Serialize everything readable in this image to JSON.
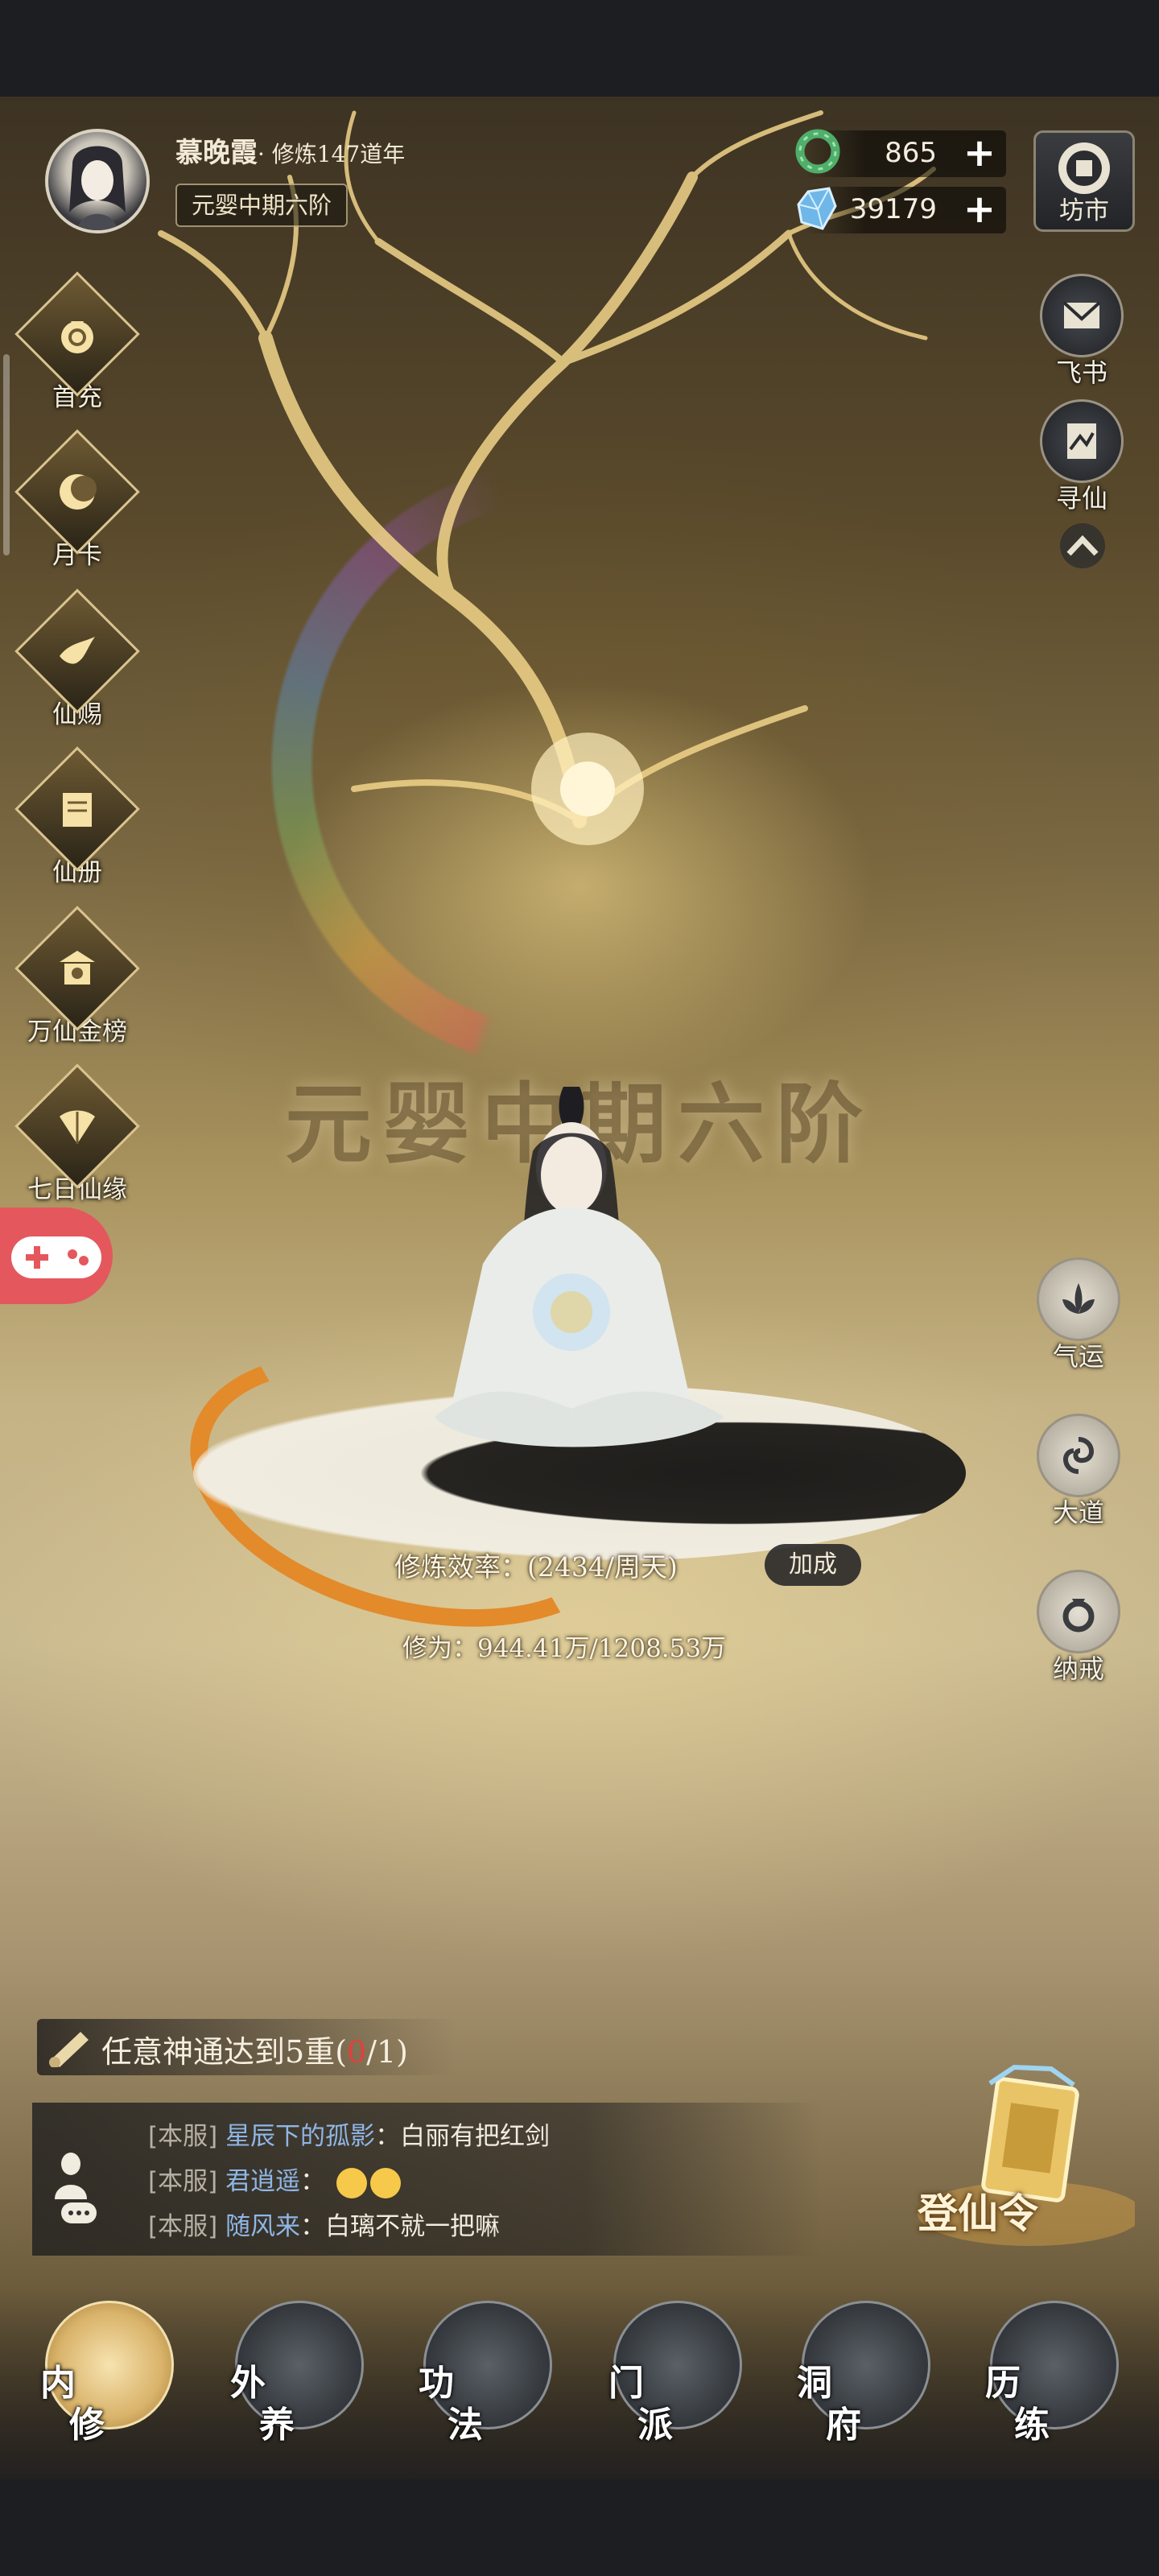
{
  "player": {
    "name": "慕晚霞",
    "cultivation_years": "· 修炼147道年",
    "realm_badge": "元婴中期六阶"
  },
  "currencies": [
    {
      "icon": "jade-ring-icon",
      "value": "865",
      "plus": "+"
    },
    {
      "icon": "spirit-crystal-icon",
      "value": "39179",
      "plus": "+"
    }
  ],
  "right_top": {
    "market": "坊市",
    "letters": "飞书",
    "seek": "寻仙",
    "collapse_icon": "chevron-up-icon"
  },
  "left_menu": [
    {
      "label": "首充",
      "icon": "money-bag-icon"
    },
    {
      "label": "月卡",
      "icon": "moon-card-icon"
    },
    {
      "label": "仙赐",
      "icon": "crane-icon"
    },
    {
      "label": "仙册",
      "icon": "book-icon"
    },
    {
      "label": "万仙金榜",
      "icon": "temple-icon"
    },
    {
      "label": "七日仙缘",
      "icon": "fan-icon"
    }
  ],
  "right_side": {
    "fortune": "气运",
    "dao": "大道",
    "ring": "纳戒"
  },
  "center": {
    "big_realm": "元婴中期六阶",
    "efficiency_label": "修炼效率：",
    "efficiency_value": "(2434/周天)",
    "bonus": "加成",
    "cultivation_label": "修为：",
    "cultivation_value": "944.41万/1208.53万"
  },
  "task": {
    "text": "任意神通达到5重",
    "progress_open": "(",
    "progress_current": "0",
    "progress_total": "/1)"
  },
  "chat": [
    {
      "server": "[本服]",
      "user": "星辰下的孤影",
      "msg": "白丽有把红剑"
    },
    {
      "server": "[本服]",
      "user": "君逍遥",
      "msg": ""
    },
    {
      "server": "[本服]",
      "user": "随风来",
      "msg": "白璃不就一把嘛"
    }
  ],
  "ascend_token": "登仙令",
  "bottom_nav": [
    {
      "c1": "内",
      "c2": "修",
      "active": true
    },
    {
      "c1": "外",
      "c2": "养",
      "active": false
    },
    {
      "c1": "功",
      "c2": "法",
      "active": false
    },
    {
      "c1": "门",
      "c2": "派",
      "active": false
    },
    {
      "c1": "洞",
      "c2": "府",
      "active": false
    },
    {
      "c1": "历",
      "c2": "练",
      "active": false
    }
  ],
  "colors": {
    "accent_gold": "#d9c38f",
    "progress_red": "#e3403c",
    "user_blue": "#8fb6e6",
    "game_btn": "#e4585d"
  }
}
